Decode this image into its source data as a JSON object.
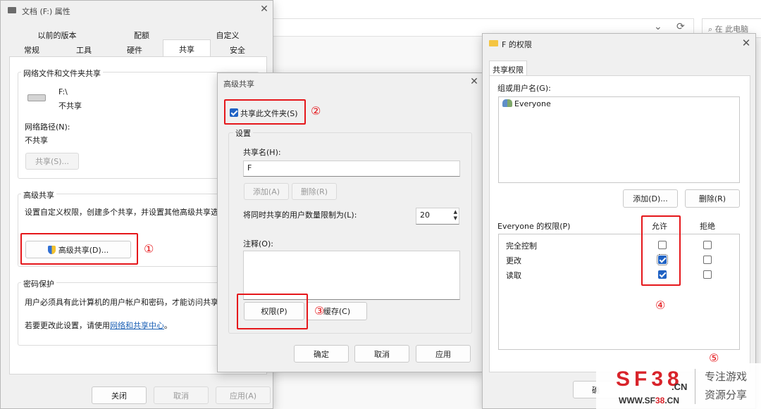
{
  "explorer": {
    "search_placeholder": "在 此电脑",
    "min_icon": "—",
    "max_icon": "☐",
    "refresh_icon": "⟳",
    "chevron_icon": "⌄"
  },
  "props": {
    "title": "文档 (F:) 属性",
    "tabs_row1": [
      "以前的版本",
      "配额",
      "自定义"
    ],
    "tabs_row2": [
      "常规",
      "工具",
      "硬件",
      "共享",
      "安全"
    ],
    "net_group": "网络文件和文件夹共享",
    "drive_name": "F:\\",
    "drive_status": "不共享",
    "net_path_label": "网络路径(N):",
    "net_path_value": "不共享",
    "share_btn": "共享(S)...",
    "adv_group": "高级共享",
    "adv_desc": "设置自定义权限，创建多个共享，并设置其他高级共享选",
    "adv_btn": "高级共享(D)...",
    "pwd_group": "密码保护",
    "pwd_desc": "用户必须具有此计算机的用户帐户和密码，才能访问共享",
    "pwd_change_prefix": "若要更改此设置，请使用",
    "pwd_link": "网络和共享中心",
    "pwd_change_suffix": "。",
    "close_btn": "关闭",
    "cancel_btn": "取消",
    "apply_btn": "应用(A)"
  },
  "adv": {
    "title": "高级共享",
    "share_check": "共享此文件夹(S)",
    "settings_group": "设置",
    "share_name_label": "共享名(H):",
    "share_name_value": "F",
    "add_btn": "添加(A)",
    "remove_btn": "删除(R)",
    "limit_label": "将同时共享的用户数量限制为(L):",
    "limit_value": "20",
    "comment_label": "注释(O):",
    "perm_btn": "权限(P)",
    "cache_btn": "缓存(C)",
    "ok_btn": "确定",
    "cancel_btn": "取消",
    "apply_btn": "应用"
  },
  "perm": {
    "title": "F 的权限",
    "tab": "共享权限",
    "group_label": "组或用户名(G):",
    "user": "Everyone",
    "add_btn": "添加(D)...",
    "remove_btn": "删除(R)",
    "perm_label": "Everyone 的权限(P)",
    "allow_col": "允许",
    "deny_col": "拒绝",
    "rows": [
      {
        "name": "完全控制",
        "allow": false,
        "deny": false
      },
      {
        "name": "更改",
        "allow": true,
        "deny": false
      },
      {
        "name": "读取",
        "allow": true,
        "deny": false
      }
    ],
    "ok_btn_partial": "确"
  },
  "markers": [
    "①",
    "②",
    "③",
    "④",
    "⑤"
  ],
  "watermark": {
    "logo": "SF38",
    "logo_suffix": ".CN",
    "line1": "专注游戏",
    "line2": "资源分享",
    "url_prefix": "WWW.SF",
    "url_num": "38",
    "url_suffix": ".CN"
  },
  "colors": {
    "accent": "#1f62c4",
    "annotation_red": "#e5171b",
    "link": "#1a5fb4",
    "watermark_red": "#d8232a"
  }
}
